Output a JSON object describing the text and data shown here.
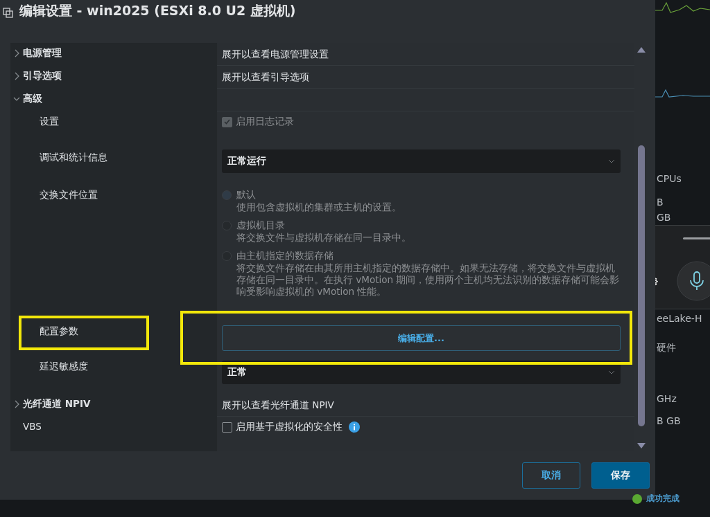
{
  "dialog": {
    "title": "编辑设置 - win2025 (ESXi 8.0 U2 虚拟机)",
    "sections": [
      {
        "kind": "collapsible",
        "label": "电源管理",
        "expanded": false,
        "summary": "展开以查看电源管理设置"
      },
      {
        "kind": "collapsible",
        "label": "引导选项",
        "expanded": false,
        "summary": "展开以查看引导选项"
      },
      {
        "kind": "collapsible",
        "label": "高级",
        "expanded": true,
        "children": [
          {
            "kind": "checkbox",
            "label": "设置",
            "text": "启用日志记录",
            "checked": true,
            "disabled": true
          },
          {
            "kind": "select",
            "label": "调试和统计信息",
            "value": "正常运行"
          },
          {
            "kind": "radios",
            "label": "交换文件位置",
            "options": [
              {
                "title": "默认",
                "description": "使用包含虚拟机的集群或主机的设置。",
                "selected": true
              },
              {
                "title": "虚拟机目录",
                "description": "将交换文件与虚拟机存储在同一目录中。",
                "selected": false
              },
              {
                "title": "由主机指定的数据存储",
                "description": "将交换文件存储在由其所用主机指定的数据存储中。如果无法存储，将交换文件与虚拟机存储在同一目录中。在执行 vMotion 期间，使用两个主机均无法识别的数据存储可能会影响受影响虚拟机的 vMotion 性能。",
                "selected": false
              }
            ]
          },
          {
            "kind": "button",
            "label": "配置参数",
            "text": "编辑配置..."
          },
          {
            "kind": "select",
            "label": "延迟敏感度",
            "value": "正常"
          }
        ]
      },
      {
        "kind": "collapsible",
        "label": "光纤通道 NPIV",
        "expanded": false,
        "summary": "展开以查看光纤通道 NPIV"
      },
      {
        "kind": "checkbox",
        "label": "VBS",
        "text": "启用基于虚拟化的安全性",
        "checked": false,
        "disabled": false,
        "info": true
      }
    ],
    "buttons": [
      {
        "label": "取消",
        "primary": false
      },
      {
        "label": "保存",
        "primary": true
      }
    ]
  },
  "background": {
    "texts": [
      "CPUs",
      "B",
      "GB",
      "eeLake-H",
      "硬件",
      "GHz",
      "B GB"
    ],
    "status": "成功完成"
  }
}
